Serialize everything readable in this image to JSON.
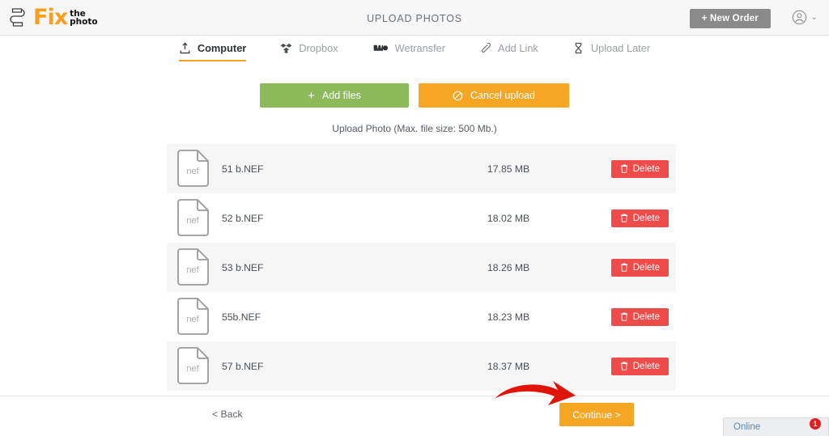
{
  "header": {
    "logo_fix": "Fix",
    "logo_the": "the",
    "logo_photo": "photo",
    "title": "UPLOAD PHOTOS",
    "new_order_label": "+ New Order",
    "account_icon": "user-circle-icon",
    "account_chevron": "⌄"
  },
  "tabs": [
    {
      "label": "Computer",
      "icon": "upload-icon",
      "active": true
    },
    {
      "label": "Dropbox",
      "icon": "dropbox-icon",
      "active": false
    },
    {
      "label": "Wetransfer",
      "icon": "wetransfer-icon",
      "active": false
    },
    {
      "label": "Add Link",
      "icon": "link-icon",
      "active": false
    },
    {
      "label": "Upload Later",
      "icon": "hourglass-icon",
      "active": false
    }
  ],
  "actions": {
    "add_files_label": "Add files",
    "add_files_icon": "plus-icon",
    "cancel_upload_label": "Cancel upload",
    "cancel_upload_icon": "ban-icon",
    "hint": "Upload Photo (Max. file size: 500 Mb.)"
  },
  "files": [
    {
      "icon_label": "nef",
      "name": "51 b.NEF",
      "size": "17.85 MB",
      "delete_label": "Delete"
    },
    {
      "icon_label": "nef",
      "name": "52 b.NEF",
      "size": "18.02 MB",
      "delete_label": "Delete"
    },
    {
      "icon_label": "nef",
      "name": "53 b.NEF",
      "size": "18.26 MB",
      "delete_label": "Delete"
    },
    {
      "icon_label": "nef",
      "name": "55b.NEF",
      "size": "18.23 MB",
      "delete_label": "Delete"
    },
    {
      "icon_label": "nef",
      "name": "57 b.NEF",
      "size": "18.37 MB",
      "delete_label": "Delete"
    }
  ],
  "footer": {
    "back_label": "< Back",
    "continue_label": "Continue >",
    "annotation_icon": "red-curved-arrow"
  },
  "chat": {
    "label": "Online",
    "badge": "1"
  },
  "colors": {
    "brand_orange": "#f7a020",
    "button_orange": "#f6a623",
    "green": "#8cba5a",
    "delete_red": "#ee4b4b",
    "arrow_red": "#e0140a",
    "header_bg": "#f7f7f7",
    "row_alt_bg": "#f6f6f6",
    "new_order_gray": "#8a8a8a"
  }
}
